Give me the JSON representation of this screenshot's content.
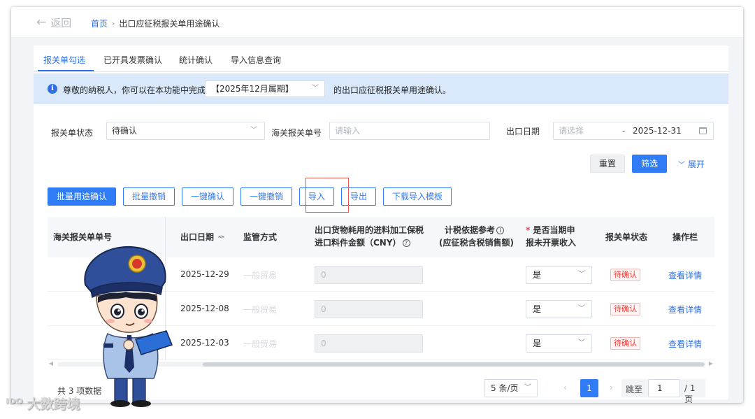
{
  "header": {
    "back_label": "返回",
    "breadcrumb_home": "首页",
    "breadcrumb_current": "出口应征税报关单用途确认"
  },
  "tabs": [
    {
      "label": "报关单勾选",
      "active": true
    },
    {
      "label": "已开具发票确认",
      "active": false
    },
    {
      "label": "统计确认",
      "active": false
    },
    {
      "label": "导入信息查询",
      "active": false
    }
  ],
  "notice": {
    "text_before": "尊敬的纳税人，你可以在本功能中完成",
    "period_value": "【2025年12月属期】",
    "text_after": "的出口应征税报关单用途确认。"
  },
  "filters": {
    "status_label": "报关单状态",
    "status_value": "待确认",
    "customs_no_label": "海关报关单号",
    "customs_no_placeholder": "请输入",
    "export_date_label": "出口日期",
    "export_date_start_placeholder": "请选择",
    "export_date_separator": "-",
    "export_date_end": "2025-12-31"
  },
  "actions": {
    "reset": "重置",
    "filter": "筛选",
    "expand": "展开"
  },
  "toolbar": {
    "batch_confirm": "批量用途确认",
    "batch_revoke": "批量撤销",
    "one_click_confirm": "一键确认",
    "one_click_revoke": "一键撤销",
    "import": "导入",
    "export": "导出",
    "download_template": "下载导入模板"
  },
  "table": {
    "columns": {
      "customs_no": "海关报关单单号",
      "export_date": "出口日期",
      "supervision": "监管方式",
      "amount_line1": "出口货物耗用的进料加工保税",
      "amount_line2": "进口料件金额（CNY）",
      "tax_basis_line1": "计税依据参考",
      "tax_basis_line2": "(应征税含税销售额)",
      "uninvoiced_req": "*",
      "uninvoiced_line1": "是否当期申",
      "uninvoiced_line2": "报未开票收入",
      "status": "报关单状态",
      "ops": "操作栏"
    },
    "rows": [
      {
        "export_date": "2025-12-29",
        "supervision": "一般贸易",
        "amount": "0",
        "uninvoiced": "是",
        "status": "待确认",
        "action": "查看详情"
      },
      {
        "export_date": "2025-12-08",
        "supervision": "一般贸易",
        "amount": "0",
        "uninvoiced": "是",
        "status": "待确认",
        "action": "查看详情"
      },
      {
        "export_date": "2025-12-03",
        "supervision": "一般贸易",
        "amount": "0",
        "uninvoiced": "是",
        "status": "待确认",
        "action": "查看详情"
      }
    ]
  },
  "footer": {
    "total": "共 3 项数据",
    "page_size": "5 条/页",
    "current_page": "1",
    "jump_label": "跳至",
    "jump_value": "1",
    "total_pages": "/ 1 页"
  },
  "watermark": "大数跨境",
  "colors": {
    "primary": "#2f7cf6",
    "notice_bg": "#d9e9fb",
    "status_red": "#e64340",
    "highlight": "#e05a52"
  }
}
